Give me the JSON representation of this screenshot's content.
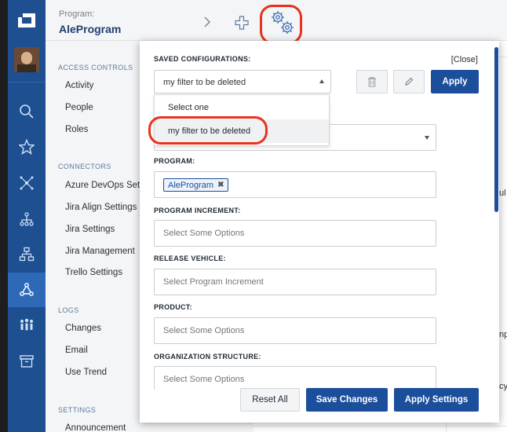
{
  "header": {
    "program_label": "Program:",
    "program_name": "AleProgram"
  },
  "rail": {
    "icons": [
      "search-icon",
      "star-icon",
      "network-icon",
      "hierarchy-icon",
      "org-chart-icon",
      "flow-icon",
      "team-icon",
      "archive-icon"
    ],
    "active_index": 5,
    "accent": "#1d4f91"
  },
  "admin_menu": {
    "access_controls": {
      "heading": "ACCESS CONTROLS",
      "items": [
        "Activity",
        "People",
        "Roles"
      ]
    },
    "connectors": {
      "heading": "CONNECTORS",
      "items": [
        "Azure DevOps Set",
        "Jira Align Settings",
        "Jira Settings",
        "Jira Management",
        "Trello Settings"
      ]
    },
    "logs": {
      "heading": "LOGS",
      "items": [
        "Changes",
        "Email",
        "Use Trend"
      ]
    },
    "settings": {
      "heading": "SETTINGS",
      "items": [
        "Announcement"
      ]
    }
  },
  "background_fragments": {
    "f1": "ul",
    "f2": "np",
    "f3": "cy"
  },
  "modal": {
    "close_label": "[Close]",
    "saved_configurations": {
      "label": "SAVED CONFIGURATIONS:",
      "selected": "my filter to be deleted",
      "apply_label": "Apply",
      "options": [
        "Select one",
        "my filter to be deleted"
      ]
    },
    "program": {
      "label": "PROGRAM:",
      "tag": "AleProgram",
      "tag_remove": "✖"
    },
    "program_increment": {
      "label": "PROGRAM INCREMENT:",
      "placeholder": "Select Some Options"
    },
    "release_vehicle": {
      "label": "RELEASE VEHICLE:",
      "placeholder": "Select Program Increment"
    },
    "product": {
      "label": "PRODUCT:",
      "placeholder": "Select Some Options"
    },
    "organization_structure": {
      "label": "ORGANIZATION STRUCTURE:",
      "placeholder": "Select Some Options"
    },
    "footer": {
      "reset_label": "Reset All",
      "save_label": "Save Changes",
      "apply_settings_label": "Apply Settings"
    },
    "primary_color": "#1b4e9b",
    "highlight_color": "#e8321c"
  }
}
